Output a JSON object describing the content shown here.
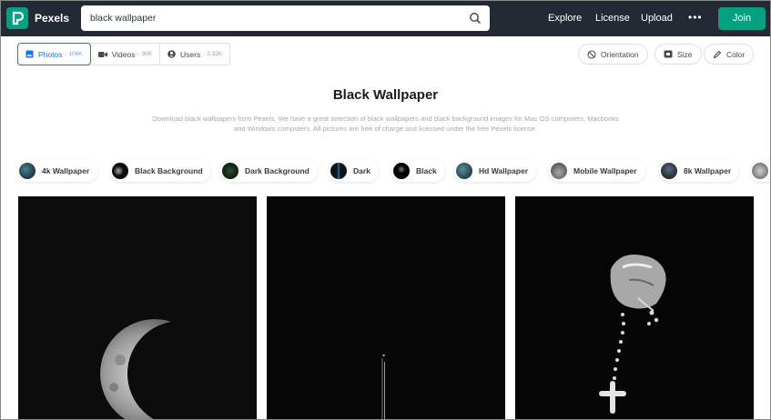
{
  "header": {
    "brand": "Pexels",
    "search_value": "black wallpaper",
    "nav": [
      "Explore",
      "License",
      "Upload"
    ],
    "more": "•••",
    "join_label": "Join"
  },
  "tabs": [
    {
      "label": "Photos",
      "count": "· 106K",
      "icon": "image-icon",
      "active": true
    },
    {
      "label": "Videos",
      "count": "· 30K",
      "icon": "video-icon",
      "active": false
    },
    {
      "label": "Users",
      "count": "· 2.32K",
      "icon": "user-icon",
      "active": false
    }
  ],
  "filters": {
    "orientation": "Orientation",
    "size": "Size",
    "color": "Color"
  },
  "page": {
    "title": "Black Wallpaper",
    "description": "Download black wallpapers from Pexels. We have a great selection of black wallpapers and black background images for Mac OS computers. Macbooks and Windows computers. All pictures are free of charge and licensed under the free Pexels license."
  },
  "chips": [
    {
      "label": "4k Wallpaper"
    },
    {
      "label": "Black Background"
    },
    {
      "label": "Dark Background"
    },
    {
      "label": "Dark"
    },
    {
      "label": "Black"
    },
    {
      "label": "Hd Wallpaper"
    },
    {
      "label": "Mobile Wallpaper"
    },
    {
      "label": "8k Wallpaper"
    }
  ],
  "colors": {
    "brand_green": "#05a081",
    "header_bg": "#232a34",
    "active_blue": "#1a73e8"
  }
}
